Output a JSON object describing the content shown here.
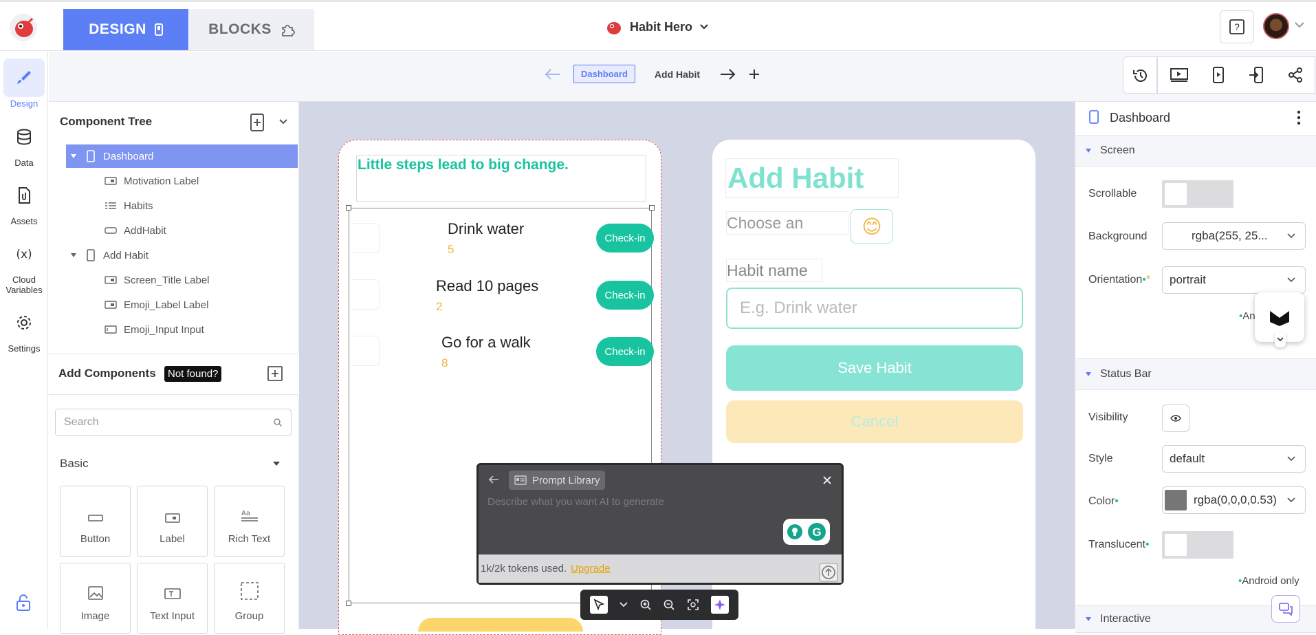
{
  "topbar": {
    "design_tab": "DESIGN",
    "blocks_tab": "BLOCKS",
    "project_name": "Habit Hero"
  },
  "rail": {
    "items": [
      {
        "label": "Design"
      },
      {
        "label": "Data"
      },
      {
        "label": "Assets"
      },
      {
        "label": "Cloud Variables"
      },
      {
        "label": "Settings"
      }
    ]
  },
  "screens": {
    "tabs": [
      "Dashboard",
      "Add Habit"
    ],
    "current": "Dashboard"
  },
  "component_tree": {
    "title": "Component Tree",
    "rows": [
      {
        "label": "Dashboard",
        "level": 0,
        "selected": true
      },
      {
        "label": "Motivation Label",
        "level": 1
      },
      {
        "label": "Habits",
        "level": 1
      },
      {
        "label": "AddHabit",
        "level": 1
      },
      {
        "label": "Add Habit",
        "level": 0
      },
      {
        "label": "Screen_Title Label",
        "level": 1
      },
      {
        "label": "Emoji_Label Label",
        "level": 1
      },
      {
        "label": "Emoji_Input Input",
        "level": 1
      }
    ]
  },
  "add_components": {
    "title": "Add Components",
    "not_found": "Not found?",
    "search_placeholder": "Search",
    "category": "Basic",
    "items": [
      "Button",
      "Label",
      "Rich Text",
      "Image",
      "Text Input",
      "Group"
    ]
  },
  "dashboard": {
    "motivation": "Little steps lead to big change.",
    "habits": [
      {
        "name": "Drink water",
        "count": "5",
        "button": "Check-in"
      },
      {
        "name": "Read 10 pages",
        "count": "2",
        "button": "Check-in"
      },
      {
        "name": "Go for a walk",
        "count": "8",
        "button": "Check-in"
      }
    ]
  },
  "add_habit": {
    "title": "Add Habit",
    "choose_label": "Choose an",
    "emoji": "😊",
    "habit_name_label": "Habit name",
    "habit_name_placeholder": "E.g. Drink water",
    "save": "Save Habit",
    "cancel": "Cancel"
  },
  "ai_prompt": {
    "library": "Prompt Library",
    "placeholder": "Describe what you want AI to generate",
    "tokens": "1k/2k tokens used.",
    "upgrade": "Upgrade"
  },
  "properties": {
    "screen_name": "Dashboard",
    "sections": {
      "screen": "Screen",
      "status_bar": "Status Bar",
      "interactive": "Interactive"
    },
    "scrollable_label": "Scrollable",
    "background_label": "Background",
    "background_value": "rgba(255, 25...",
    "orientation_label": "Orientation",
    "orientation_value": "portrait",
    "android_note_short": "An",
    "visibility_label": "Visibility",
    "style_label": "Style",
    "style_value": "default",
    "color_label": "Color",
    "color_value": "rgba(0,0,0,0.53)",
    "translucent_label": "Translucent",
    "android_only": "Android only"
  },
  "colors": {
    "accent": "#5d7ff5",
    "teal": "#18c3a0",
    "yellow": "#f2b33d"
  }
}
